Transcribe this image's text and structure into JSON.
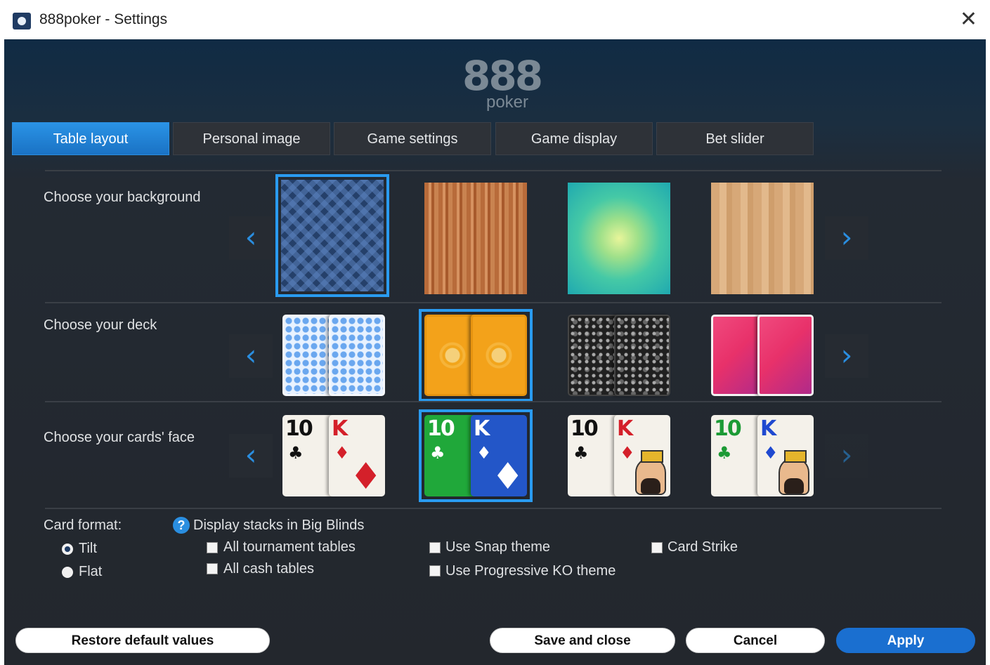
{
  "window": {
    "title": "888poker - Settings",
    "close_glyph": "✕"
  },
  "logo": {
    "top": "888",
    "bottom": "poker"
  },
  "tabs": [
    {
      "label": "Table layout",
      "active": true
    },
    {
      "label": "Personal image",
      "active": false
    },
    {
      "label": "Game settings",
      "active": false
    },
    {
      "label": "Game display",
      "active": false
    },
    {
      "label": "Bet slider",
      "active": false
    }
  ],
  "rows": {
    "background": {
      "label": "Choose your background",
      "selected_index": 0
    },
    "deck": {
      "label": "Choose your deck",
      "selected_index": 1
    },
    "faces": {
      "label": "Choose your cards' face",
      "selected_index": 1
    }
  },
  "arrows": {
    "prev": "‹",
    "next": "›"
  },
  "cards": {
    "ten": "10",
    "king": "K",
    "club": "♣",
    "diamond": "♦"
  },
  "card_format": {
    "label": "Card format:",
    "options": [
      {
        "label": "Tilt",
        "selected": true
      },
      {
        "label": "Flat",
        "selected": false
      }
    ]
  },
  "stacks": {
    "help": "?",
    "label": "Display stacks in Big Blinds",
    "options": [
      {
        "label": "All tournament tables",
        "checked": false
      },
      {
        "label": "All cash tables",
        "checked": false
      }
    ]
  },
  "themes": [
    {
      "label": "Use Snap theme",
      "checked": false
    },
    {
      "label": "Use Progressive KO theme",
      "checked": false
    },
    {
      "label": "Card Strike",
      "checked": false
    }
  ],
  "buttons": {
    "restore": "Restore default values",
    "save_close": "Save and close",
    "cancel": "Cancel",
    "apply": "Apply"
  },
  "colors": {
    "accent": "#2a8ee0",
    "apply": "#1a6fd0",
    "panel": "#23272d"
  }
}
